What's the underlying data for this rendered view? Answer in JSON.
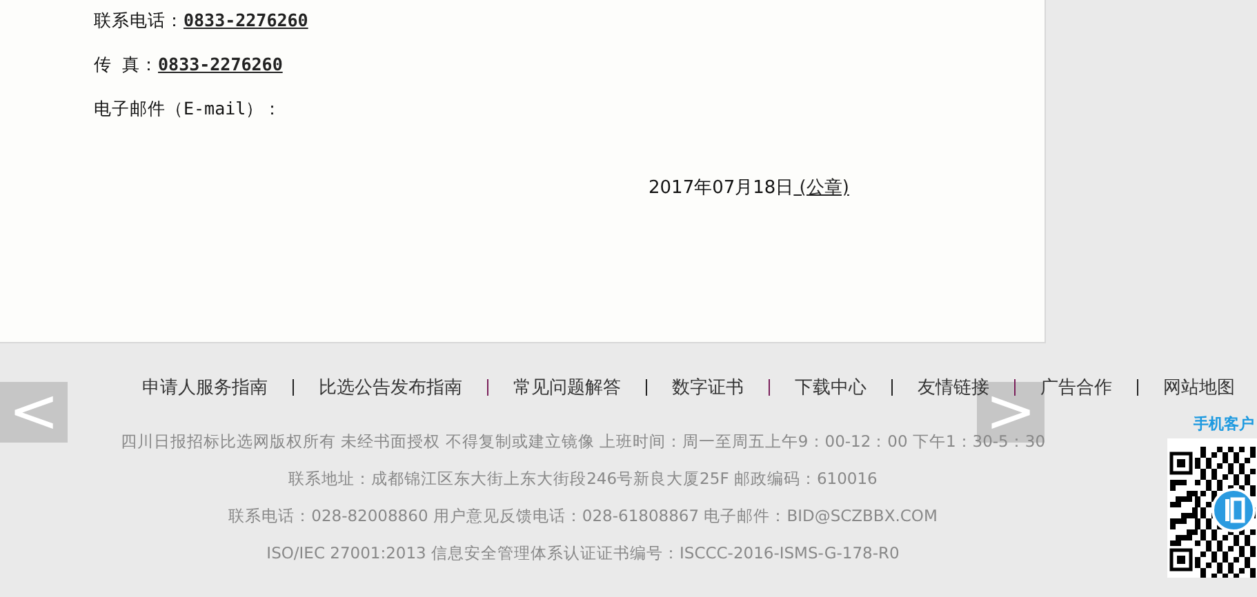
{
  "contact": [
    {
      "label": "联系电话：",
      "value": "0833-2276260"
    },
    {
      "label": "传 真：",
      "value": "0833-2276260"
    },
    {
      "label": "电子邮件（E-mail）："
    }
  ],
  "signature": {
    "date": "2017年07月18日",
    "stamp": " (公章)"
  },
  "footer": {
    "nav": [
      "申请人服务指南",
      "比选公告发布指南",
      "常见问题解答",
      "数字证书",
      "下载中心",
      "友情链接",
      "广告合作",
      "网站地图"
    ],
    "lines": [
      "四川日报招标比选网版权所有 未经书面授权 不得复制或建立镜像 上班时间：周一至周五上午9：00-12：00 下午1：30-5：30",
      "联系地址：成都锦江区东大街上东大街段246号新良大厦25F 邮政编码：610016",
      "联系电话：028-82008860 用户意见反馈电话：028-61808867 电子邮件：BID@SCZBBX.COM",
      "ISO/IEC 27001:2013 信息安全管理体系认证证书编号：ISCCC-2016-ISMS-G-178-R0"
    ],
    "prev": "<",
    "next": ">",
    "app_label": "手机客户"
  }
}
